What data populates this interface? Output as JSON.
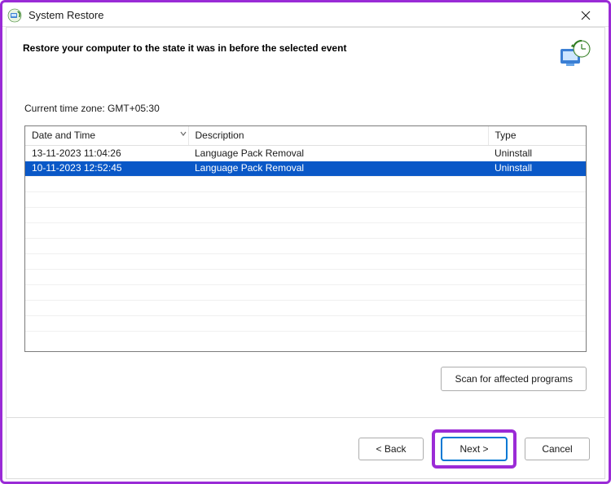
{
  "window": {
    "title": "System Restore"
  },
  "header": {
    "heading": "Restore your computer to the state it was in before the selected event"
  },
  "timezone_label": "Current time zone: GMT+05:30",
  "table": {
    "columns": {
      "datetime": "Date and Time",
      "description": "Description",
      "type": "Type"
    },
    "rows": [
      {
        "datetime": "13-11-2023 11:04:26",
        "description": "Language Pack Removal",
        "type": "Uninstall",
        "selected": false
      },
      {
        "datetime": "10-11-2023 12:52:45",
        "description": "Language Pack Removal",
        "type": "Uninstall",
        "selected": true
      }
    ]
  },
  "buttons": {
    "scan": "Scan for affected programs",
    "back": "< Back",
    "next": "Next >",
    "cancel": "Cancel"
  },
  "icons": {
    "app": "system-restore-icon",
    "header": "system-restore-large-icon",
    "close": "close-icon",
    "sort": "chevron-down-icon"
  }
}
